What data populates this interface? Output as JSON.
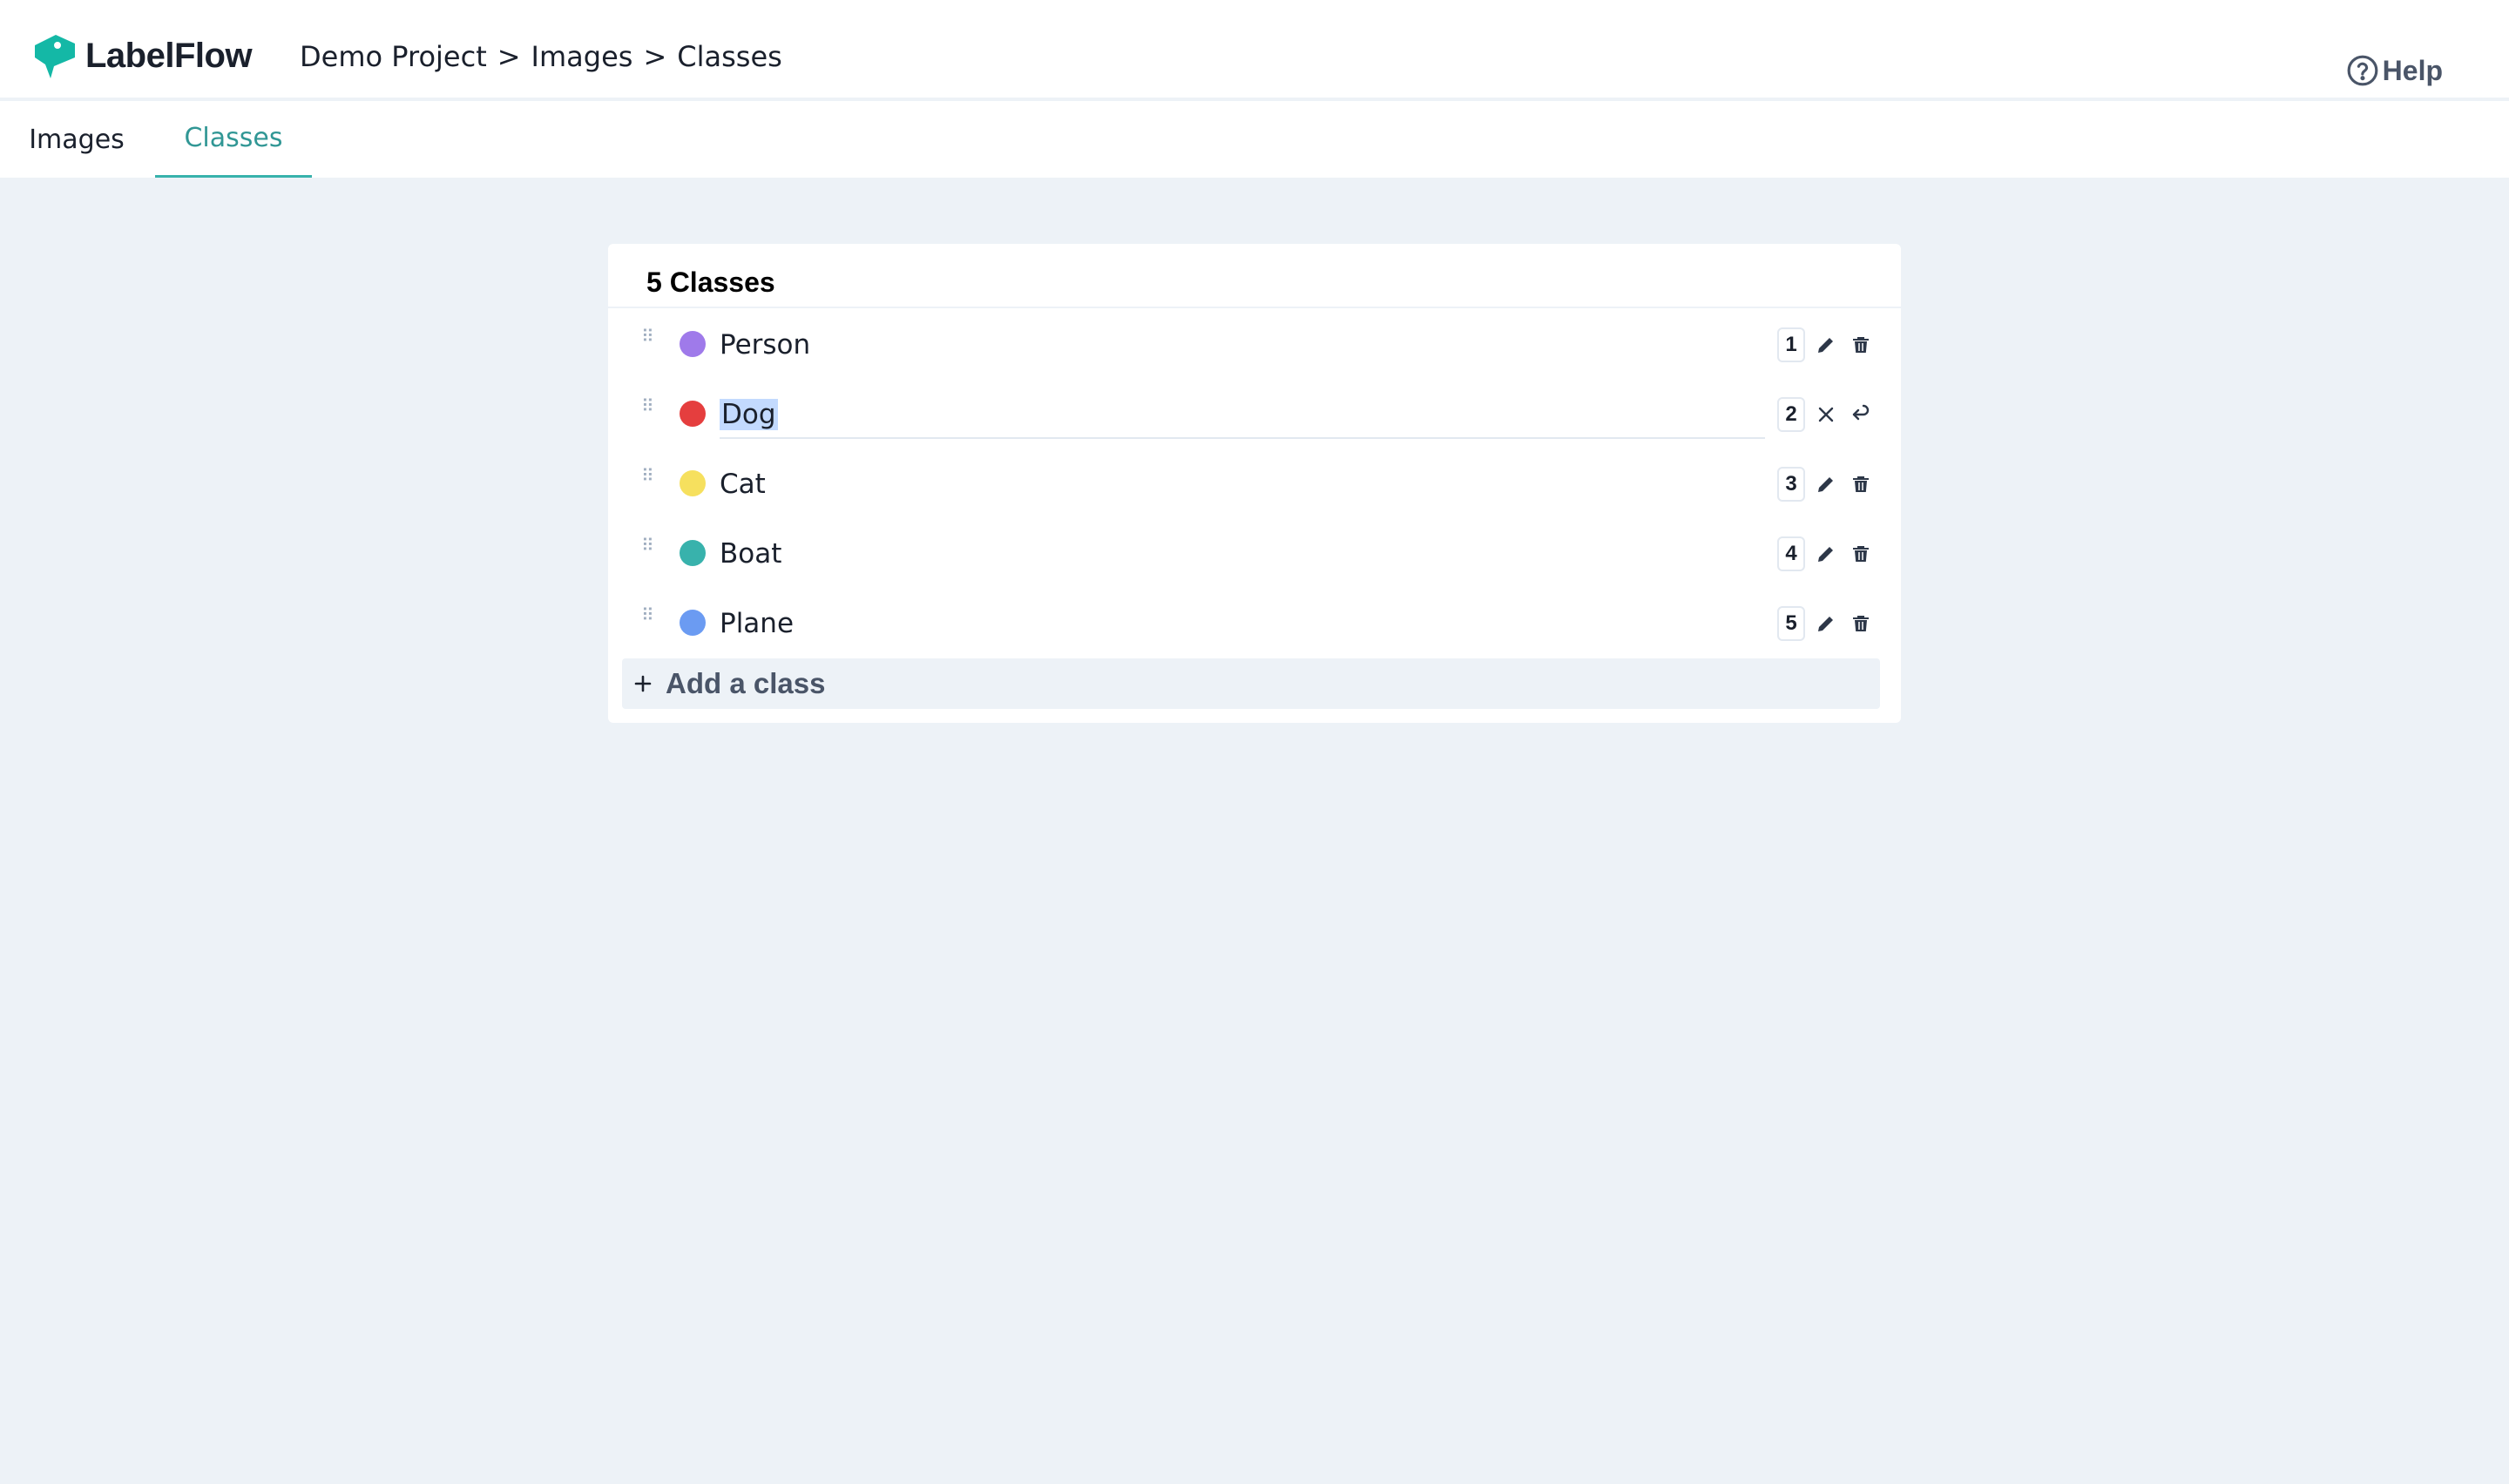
{
  "app": {
    "name": "LabelFlow",
    "accent": "#14b8a6"
  },
  "breadcrumb": [
    "Demo Project",
    "Images",
    "Classes"
  ],
  "breadcrumb_separator": ">",
  "help": {
    "label": "Help"
  },
  "tabs": [
    {
      "label": "Images",
      "active": false
    },
    {
      "label": "Classes",
      "active": true
    }
  ],
  "classes_panel": {
    "title": "5 Classes",
    "items": [
      {
        "name": "Person",
        "color": "#9f7aea",
        "shortcut": "1",
        "editing": false
      },
      {
        "name": "Dog",
        "color": "#e53e3e",
        "shortcut": "2",
        "editing": true
      },
      {
        "name": "Cat",
        "color": "#f6e05e",
        "shortcut": "3",
        "editing": false
      },
      {
        "name": "Boat",
        "color": "#38b2ac",
        "shortcut": "4",
        "editing": false
      },
      {
        "name": "Plane",
        "color": "#6b9bf2",
        "shortcut": "5",
        "editing": false
      }
    ],
    "add_label": "Add a class"
  }
}
